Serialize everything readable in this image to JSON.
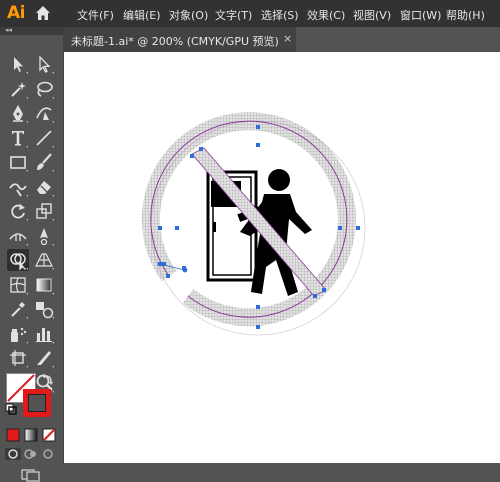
{
  "app": {
    "logo": "Ai",
    "menus": [
      "文件(F)",
      "编辑(E)",
      "对象(O)",
      "文字(T)",
      "选择(S)",
      "效果(C)",
      "视图(V)",
      "窗口(W)",
      "帮助(H)"
    ]
  },
  "document": {
    "tab_label": "未标题-1.ai* @ 200% (CMYK/GPU 预览)",
    "close_glyph": "×"
  },
  "toolbar": {
    "collapse_glyph": "◂◂",
    "tools": [
      "selection-tool",
      "direct-selection-tool",
      "magic-wand-tool",
      "lasso-tool",
      "pen-tool",
      "curvature-tool",
      "type-tool",
      "line-segment-tool",
      "rectangle-tool",
      "paintbrush-tool",
      "shaper-tool",
      "eraser-tool",
      "rotate-tool",
      "scale-tool",
      "width-tool",
      "puppet-warp-tool",
      "shape-builder-tool",
      "perspective-grid-tool",
      "mesh-tool",
      "gradient-tool",
      "eyedropper-tool",
      "blend-tool",
      "symbol-sprayer-tool",
      "column-graph-tool",
      "artboard-tool",
      "slice-tool",
      "hand-tool",
      "zoom-tool"
    ],
    "active_tool": "shape-builder-tool"
  },
  "colors": {
    "menubar": "#323232",
    "panel": "#535353",
    "canvas": "#ffffff",
    "accent_logo": "#ff9a00",
    "stroke_swatch": "#e11b1b",
    "selection_path": "#8a3a9a",
    "anchor": "#2d6fd6",
    "sign_fill": "#d7d7d7"
  }
}
